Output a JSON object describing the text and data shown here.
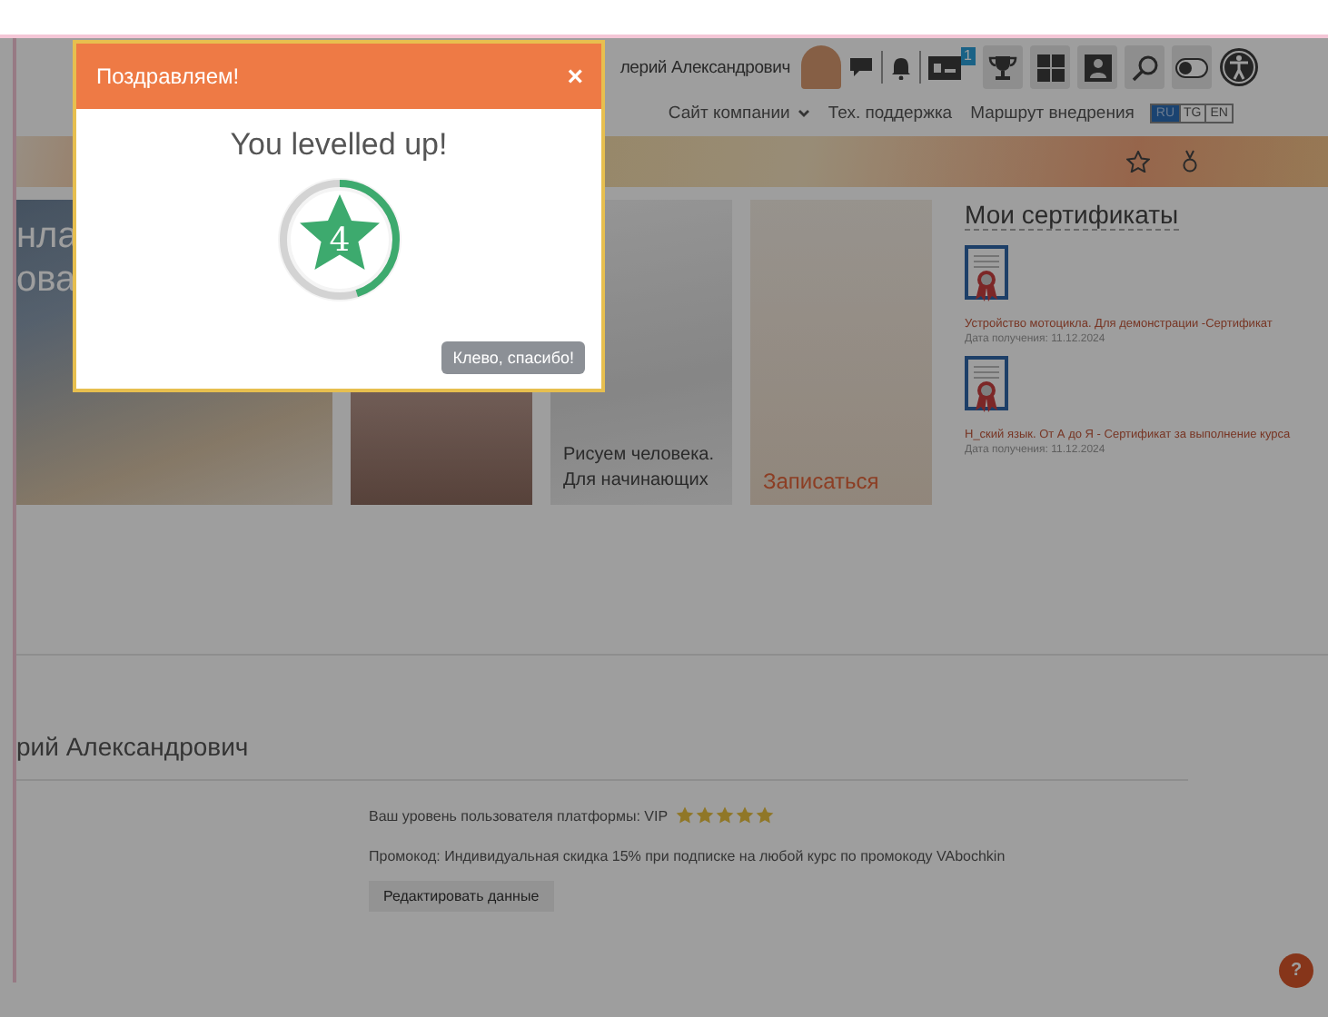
{
  "header": {
    "user_name": "лерий Александрович",
    "notification_badge": "1",
    "nav_links": [
      {
        "label": "Сайт компании",
        "has_menu": true
      },
      {
        "label": "Тех. поддержка",
        "has_menu": false
      },
      {
        "label": "Маршрут внедрения",
        "has_menu": false
      }
    ],
    "languages": [
      {
        "label": "RU",
        "selected": true
      },
      {
        "label": "TG",
        "selected": false
      },
      {
        "label": "EN",
        "selected": false
      }
    ]
  },
  "courses": [
    {
      "kind": "hero",
      "title_lines": [
        "нла",
        "ова"
      ]
    },
    {
      "kind": "portrait"
    },
    {
      "kind": "sketch",
      "title_lines": [
        "Рисуем человека.",
        "Для начинающих"
      ]
    },
    {
      "kind": "diagram",
      "action": "Записаться"
    }
  ],
  "certificates": {
    "title": "Мои сертификаты",
    "items": [
      {
        "name": "Устройство мотоцикла. Для демонстрации -Сертификат",
        "date": "Дата получения: 11.12.2024"
      },
      {
        "name": "Н_ский язык. От А до Я - Сертификат за выполнение курса",
        "date": "Дата получения: 11.12.2024"
      }
    ]
  },
  "profile": {
    "name": "рий Александрович",
    "level_label": "Ваш уровень пользователя платформы: VIP",
    "stars": 5,
    "promo": "Промокод: Индивидуальная скидка 15% при подписке на любой курс по промокоду VAbochkin",
    "edit_button": "Редактировать данные"
  },
  "help_button": "?",
  "modal": {
    "title": "Поздравляем!",
    "close": "×",
    "heading": "You levelled up!",
    "level_number": "4",
    "level": 0.45,
    "button": "Клево, спасибо!"
  }
}
